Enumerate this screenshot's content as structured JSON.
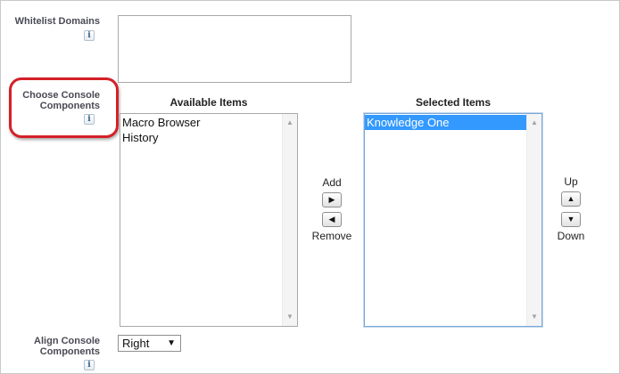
{
  "whitelist_domains": {
    "label": "Whitelist Domains",
    "info_icon": "i",
    "value": ""
  },
  "console_components": {
    "label_line1": "Choose Console",
    "label_line2": "Components",
    "info_icon": "i",
    "available": {
      "heading": "Available Items",
      "items": [
        "Macro Browser",
        "History"
      ]
    },
    "selected": {
      "heading": "Selected Items",
      "items": [
        "Knowledge One"
      ],
      "highlighted": "Knowledge One"
    },
    "add_label": "Add",
    "remove_label": "Remove",
    "up_label": "Up",
    "down_label": "Down",
    "add_icon": "▶",
    "remove_icon": "◀",
    "up_icon": "▲",
    "down_icon": "▼",
    "scroll_up_icon": "▲",
    "scroll_down_icon": "▼"
  },
  "align_console": {
    "label_line1": "Align Console",
    "label_line2": "Components",
    "info_icon": "i",
    "selected_value": "Right",
    "dropdown_icon": "▼"
  },
  "colors": {
    "highlight_ring": "#d42027",
    "selected_item_bg": "#3399ff",
    "label_text": "#4a4a56"
  }
}
